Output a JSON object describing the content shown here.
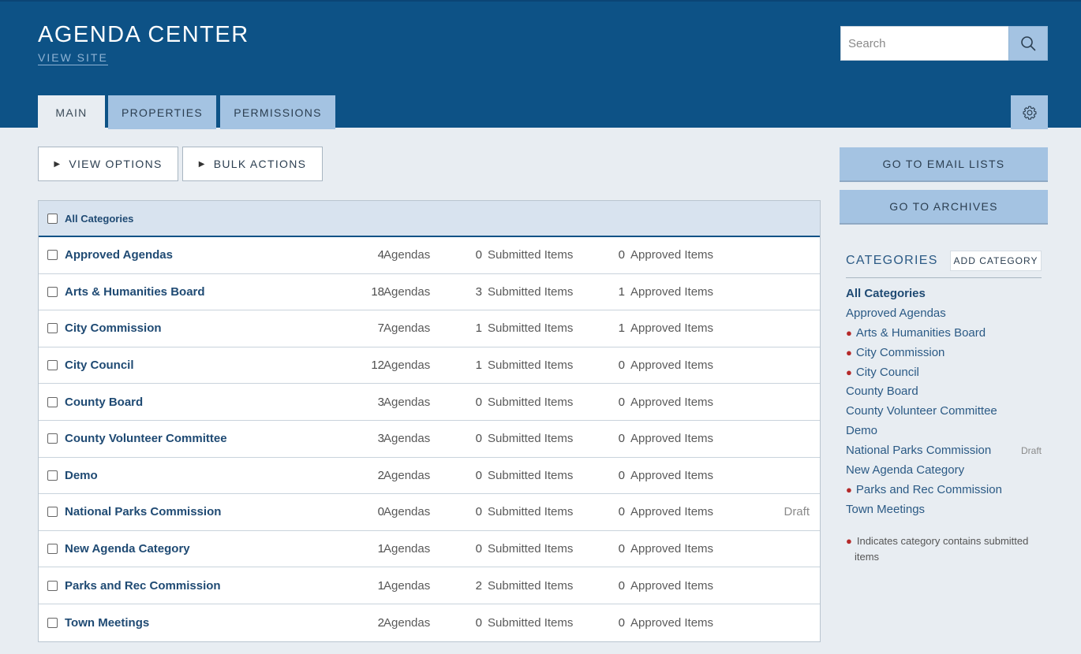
{
  "header": {
    "title": "AGENDA CENTER",
    "view_site": "VIEW SITE",
    "search_placeholder": "Search"
  },
  "tabs": [
    {
      "label": "MAIN",
      "active": true
    },
    {
      "label": "PROPERTIES",
      "active": false
    },
    {
      "label": "PERMISSIONS",
      "active": false
    }
  ],
  "toolbar": {
    "view_options": "VIEW OPTIONS",
    "bulk_actions": "BULK ACTIONS"
  },
  "table": {
    "header_label": "All Categories",
    "agendas_unit": "Agendas",
    "submitted_unit": "Submitted Items",
    "approved_unit": "Approved Items",
    "rows": [
      {
        "name": "Approved Agendas",
        "agendas": "4",
        "submitted": "0",
        "approved": "0",
        "status": ""
      },
      {
        "name": "Arts & Humanities Board",
        "agendas": "18",
        "submitted": "3",
        "approved": "1",
        "status": ""
      },
      {
        "name": "City Commission",
        "agendas": "7",
        "submitted": "1",
        "approved": "1",
        "status": ""
      },
      {
        "name": "City Council",
        "agendas": "12",
        "submitted": "1",
        "approved": "0",
        "status": ""
      },
      {
        "name": "County Board",
        "agendas": "3",
        "submitted": "0",
        "approved": "0",
        "status": ""
      },
      {
        "name": "County Volunteer Committee",
        "agendas": "3",
        "submitted": "0",
        "approved": "0",
        "status": ""
      },
      {
        "name": "Demo",
        "agendas": "2",
        "submitted": "0",
        "approved": "0",
        "status": ""
      },
      {
        "name": "National Parks Commission",
        "agendas": "0",
        "submitted": "0",
        "approved": "0",
        "status": "Draft"
      },
      {
        "name": "New Agenda Category",
        "agendas": "1",
        "submitted": "0",
        "approved": "0",
        "status": ""
      },
      {
        "name": "Parks and Rec Commission",
        "agendas": "1",
        "submitted": "2",
        "approved": "0",
        "status": ""
      },
      {
        "name": "Town Meetings",
        "agendas": "2",
        "submitted": "0",
        "approved": "0",
        "status": ""
      }
    ]
  },
  "sidebar": {
    "email_lists": "GO TO EMAIL LISTS",
    "archives": "GO TO ARCHIVES",
    "categories_heading": "CATEGORIES",
    "add_category": "ADD CATEGORY",
    "items": [
      {
        "label": "All Categories",
        "bold": true,
        "submitted": false,
        "status": ""
      },
      {
        "label": "Approved Agendas",
        "bold": false,
        "submitted": false,
        "status": ""
      },
      {
        "label": "Arts & Humanities Board",
        "bold": false,
        "submitted": true,
        "status": ""
      },
      {
        "label": "City Commission",
        "bold": false,
        "submitted": true,
        "status": ""
      },
      {
        "label": "City Council",
        "bold": false,
        "submitted": true,
        "status": ""
      },
      {
        "label": "County Board",
        "bold": false,
        "submitted": false,
        "status": ""
      },
      {
        "label": "County Volunteer Committee",
        "bold": false,
        "submitted": false,
        "status": ""
      },
      {
        "label": "Demo",
        "bold": false,
        "submitted": false,
        "status": ""
      },
      {
        "label": "National Parks Commission",
        "bold": false,
        "submitted": false,
        "status": "Draft"
      },
      {
        "label": "New Agenda Category",
        "bold": false,
        "submitted": false,
        "status": ""
      },
      {
        "label": "Parks and Rec Commission",
        "bold": false,
        "submitted": true,
        "status": ""
      },
      {
        "label": "Town Meetings",
        "bold": false,
        "submitted": false,
        "status": ""
      }
    ],
    "legend": "Indicates category contains submitted items"
  },
  "icons": {
    "search": "search-icon",
    "settings": "gear-icon",
    "expand": "triangle-right-icon",
    "submitted_marker": "bullet-icon"
  },
  "colors": {
    "header_bg": "#0d5286",
    "accent_button": "#a4c3e2",
    "link": "#1f4a73",
    "submitted_dot": "#b52a2a",
    "page_bg": "#e8edf2"
  }
}
